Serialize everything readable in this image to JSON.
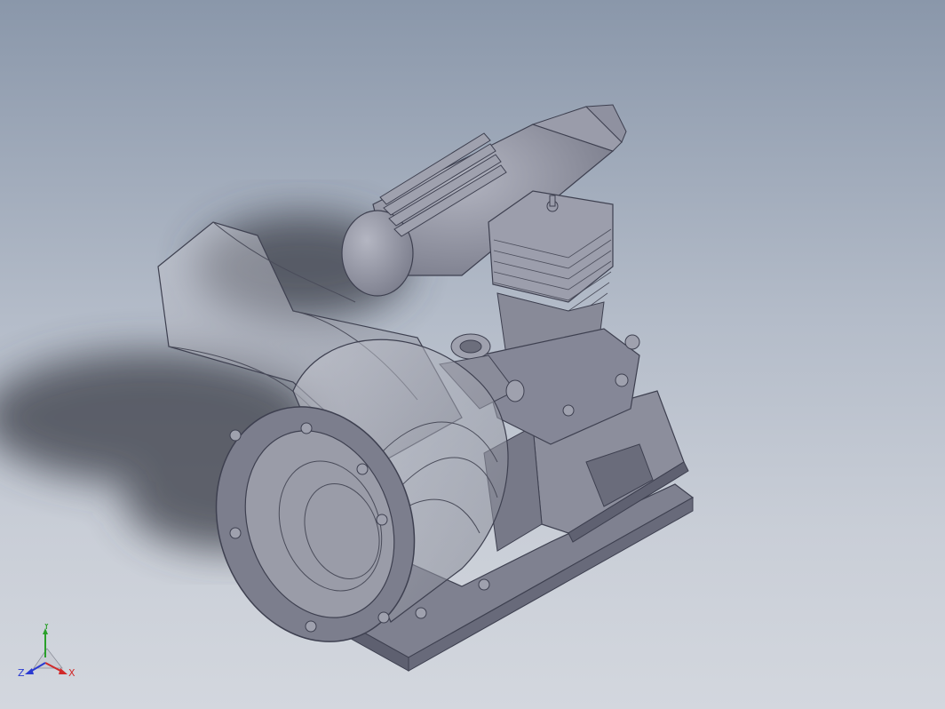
{
  "viewport": {
    "background_top": "#8a97aa",
    "background_bottom": "#d3d7de",
    "model_color": "#8e909e",
    "model_shadow": "#3a3d47"
  },
  "triad": {
    "x_label": "X",
    "y_label": "Y",
    "z_label": "Z",
    "x_color": "#d12a2a",
    "y_color": "#2aa02a",
    "z_color": "#2a3ad1"
  }
}
